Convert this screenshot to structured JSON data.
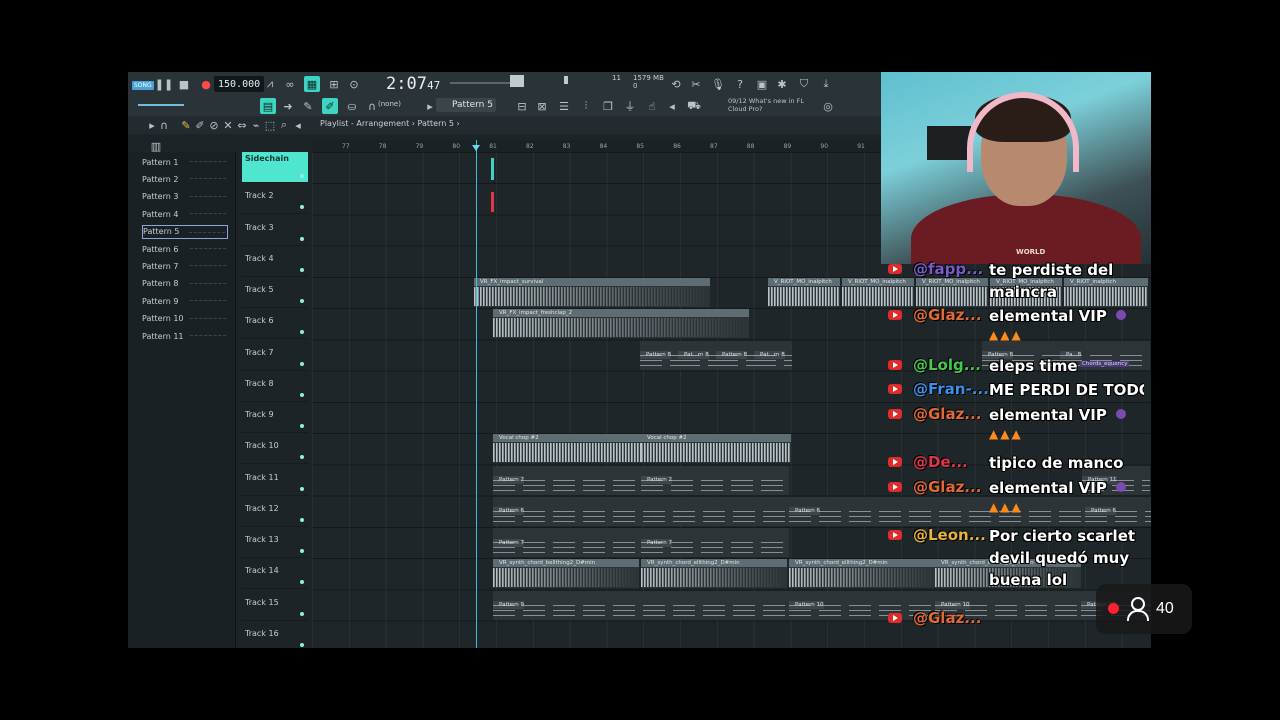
{
  "transport": {
    "mode": "SONG",
    "tempo": "150.000",
    "time": "2:07",
    "time_sub": "47",
    "mem": "1579 MB",
    "cpu_a": "11",
    "cpu_b": "0"
  },
  "toolbar2": {
    "snap": "(none)",
    "pattern": "Pattern 5",
    "news_date": "09/12",
    "news_line1": "What's new in FL",
    "news_line2": "Cloud Pro?"
  },
  "breadcrumb": {
    "root": "Playlist - Arrangement",
    "sep": "›",
    "current": "Pattern 5",
    "arrow": "›"
  },
  "patterns": [
    "Pattern 1",
    "Pattern 2",
    "Pattern 3",
    "Pattern 4",
    "Pattern 5",
    "Pattern 6",
    "Pattern 7",
    "Pattern 8",
    "Pattern 9",
    "Pattern 10",
    "Pattern 11"
  ],
  "selected_pattern": 4,
  "tracks": [
    "Sidechain",
    "Track 2",
    "Track 3",
    "Track 4",
    "Track 5",
    "Track 6",
    "Track 7",
    "Track 8",
    "Track 9",
    "Track 10",
    "Track 11",
    "Track 12",
    "Track 13",
    "Track 14",
    "Track 15",
    "Track 16"
  ],
  "ruler": [
    "77",
    "78",
    "79",
    "80",
    "81",
    "82",
    "83",
    "84",
    "85",
    "86",
    "87",
    "88",
    "89",
    "90",
    "91"
  ],
  "clips": {
    "impact_survival": "VR_FX_impact_survival",
    "impact_fresh": "VR_FX_impact_freshclap_2",
    "riot_1": "V_RIOT_MO_inalpitch",
    "riot_2": "V_RIOT_MO_inalpitch",
    "riot_3": "V_RIOT_MO_inalpitch",
    "riot_4": "V_RIOT_MO_inalpitch",
    "riot_5": "V_RIOT_inalpitch",
    "p8_a": "Pattern 8",
    "p8_b": "Pat...rn 8",
    "p8_c": "Pattern 8",
    "p8_d": "Pat...rn 8",
    "p8_e": "Pattern 8",
    "p8_f": "Pa...8",
    "chords": "Chords_equency",
    "vocal1": "Vocal chop #2",
    "vocal2": "Vocal chop #2",
    "p2_a": "Pattern 2",
    "p2_b": "Pattern 2",
    "p11": "Pattern 11",
    "p6_a": "Pattern 6",
    "p6_b": "Pattern 6",
    "p6_c": "Pattern 6",
    "p7_a": "Pattern 7",
    "p7_b": "Pattern 7",
    "synth1": "VR_synth_chord_bellthing2_D#min",
    "synth2": "VR_synth_chord_ellthing2_D#min",
    "synth3": "VR_synth_chord_ellthing2_D#min",
    "synth4": "VR_synth_chord_ellthing2_D#min",
    "p9": "Pattern 9",
    "p10_a": "Pattern 10",
    "p10_b": "Pattern 10",
    "p10_c": "Pattern 10"
  },
  "webcam": {
    "shirt_text": "WORLD"
  },
  "chat": [
    {
      "user": "@fapp...",
      "text": "te perdiste del",
      "color": "#7a5cc8"
    },
    {
      "user": "",
      "text": "maincra",
      "color": "#ffffff"
    },
    {
      "user": "@Glaz...",
      "text": "elemental VIP",
      "color": "#e06a35"
    },
    {
      "user": "@Lolg...",
      "text": "eleps time",
      "color": "#46c84a"
    },
    {
      "user": "@Fran-...",
      "text": "ME PERDI DE TODO",
      "color": "#3e8fe8"
    },
    {
      "user": "@Glaz...",
      "text": "elemental VIP",
      "color": "#e06a35"
    },
    {
      "user": "@De...",
      "text": "tipico de manco",
      "color": "#e0354a"
    },
    {
      "user": "@Glaz...",
      "text": "elemental VIP",
      "color": "#e06a35"
    },
    {
      "user": "@Leon...",
      "text": "Por cierto scarlet",
      "color": "#e8b43a"
    },
    {
      "user": "",
      "text": "devil quedó muy",
      "color": "#ffffff"
    },
    {
      "user": "",
      "text": "buena lol",
      "color": "#ffffff"
    },
    {
      "user": "@Glaz...",
      "text": "",
      "color": "#e06a35"
    }
  ],
  "viewers": {
    "count": "40"
  },
  "colors": {
    "accent": "#3fd3c1",
    "playhead": "#3fc0d8",
    "live": "#ff1f2d"
  }
}
